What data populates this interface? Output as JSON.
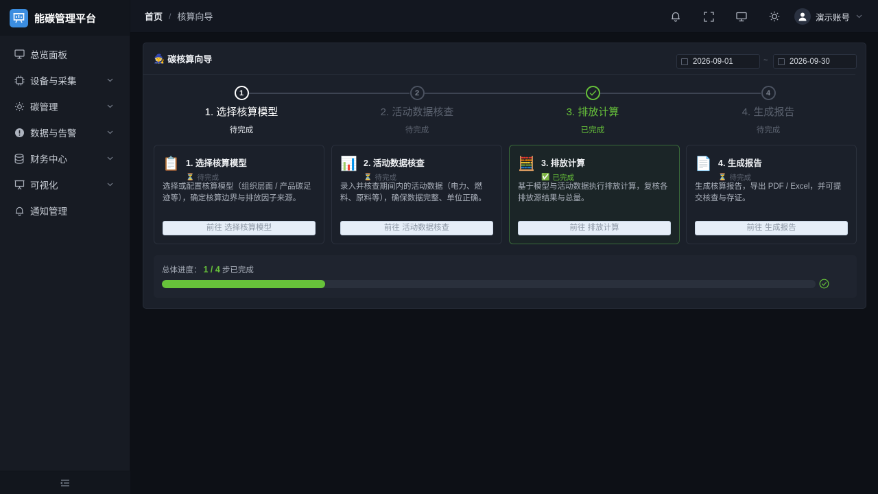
{
  "app": {
    "title": "能碳管理平台"
  },
  "sidebar": {
    "items": [
      {
        "label": "总览面板",
        "icon": "monitor-icon",
        "expandable": false
      },
      {
        "label": "设备与采集",
        "icon": "chip-icon",
        "expandable": true
      },
      {
        "label": "碳管理",
        "icon": "sun-icon",
        "expandable": true
      },
      {
        "label": "数据与告警",
        "icon": "alert-icon",
        "expandable": true
      },
      {
        "label": "财务中心",
        "icon": "database-icon",
        "expandable": true
      },
      {
        "label": "可视化",
        "icon": "presentation-icon",
        "expandable": true
      },
      {
        "label": "通知管理",
        "icon": "bell-icon",
        "expandable": false
      }
    ],
    "collapse_icon": "collapse-menu-icon"
  },
  "header": {
    "breadcrumb": {
      "home": "首页",
      "separator": "/",
      "current": "核算向导"
    },
    "icons": [
      "bell-icon",
      "fullscreen-icon",
      "monitor-icon",
      "theme-sun-icon"
    ],
    "user": {
      "name": "演示账号"
    }
  },
  "wizard": {
    "emoji": "🧙",
    "title": "碳核算向导",
    "date_start": "2026-09-01",
    "date_sep": "~",
    "date_end": "2026-09-30",
    "steps": [
      {
        "num": "1",
        "title": "1. 选择核算模型",
        "status": "待完成",
        "state": "current"
      },
      {
        "num": "2",
        "title": "2. 活动数据核查",
        "status": "待完成",
        "state": "pending"
      },
      {
        "num": "3",
        "title": "3. 排放计算",
        "status": "已完成",
        "state": "done"
      },
      {
        "num": "4",
        "title": "4. 生成报告",
        "status": "待完成",
        "state": "pending"
      }
    ],
    "tasks": [
      {
        "emoji": "📋",
        "name": "1. 选择核算模型",
        "state_icon": "⏳",
        "state": "待完成",
        "done": false,
        "desc": "选择或配置核算模型（组织层面 / 产品碳足迹等），确定核算边界与排放因子来源。",
        "button": "前往 选择核算模型"
      },
      {
        "emoji": "📊",
        "name": "2. 活动数据核查",
        "state_icon": "⏳",
        "state": "待完成",
        "done": false,
        "desc": "录入并核查期间内的活动数据（电力、燃料、原料等），确保数据完整、单位正确。",
        "button": "前往 活动数据核查"
      },
      {
        "emoji": "🧮",
        "name": "3. 排放计算",
        "state_icon": "✅",
        "state": "已完成",
        "done": true,
        "desc": "基于模型与活动数据执行排放计算，复核各排放源结果与总量。",
        "button": "前往 排放计算"
      },
      {
        "emoji": "📄",
        "name": "4. 生成报告",
        "state_icon": "⏳",
        "state": "待完成",
        "done": false,
        "desc": "生成核算报告，导出 PDF / Excel，并可提交核查与存证。",
        "button": "前往 生成报告"
      }
    ],
    "progress": {
      "prefix": "总体进度：",
      "count": "1 / 4",
      "suffix": "步已完成",
      "fraction": 0.25
    }
  },
  "colors": {
    "accent_green": "#67c23a",
    "brand_blue": "#3b8de0",
    "background": "#0d1016",
    "card": "#1b202a"
  }
}
